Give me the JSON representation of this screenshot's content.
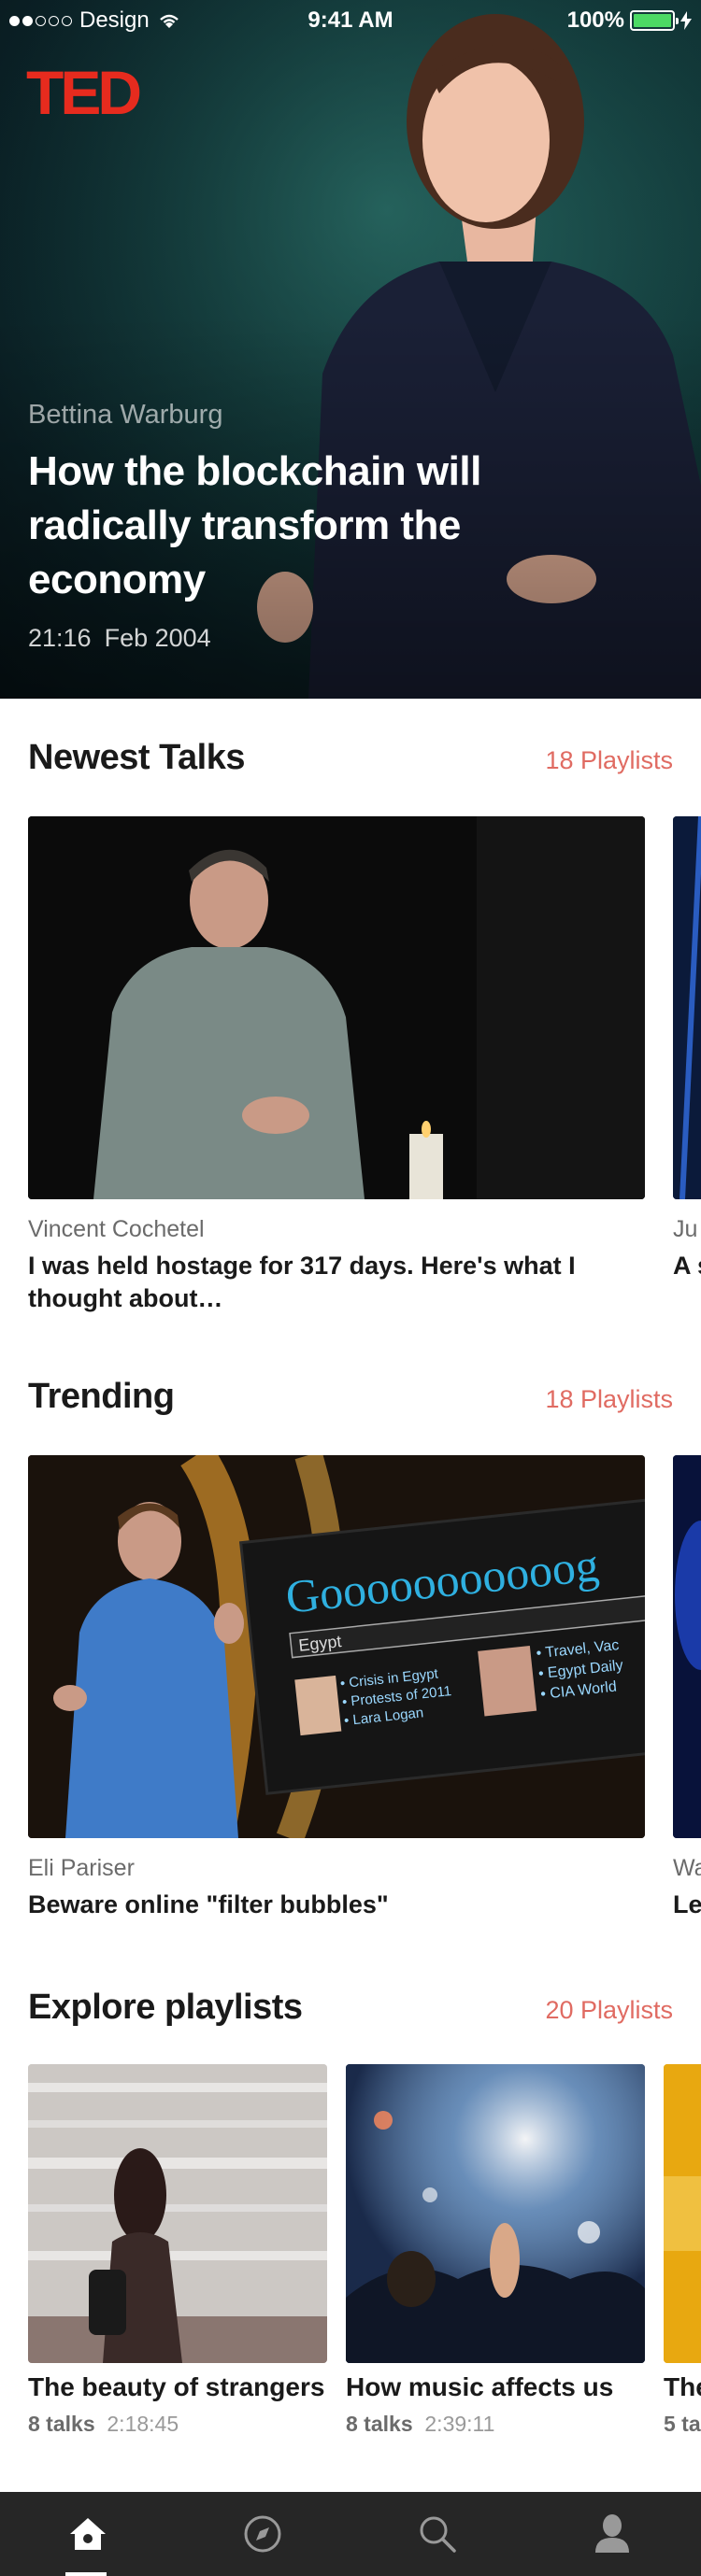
{
  "status_bar": {
    "carrier": "Design",
    "time": "9:41 AM",
    "battery": "100%"
  },
  "hero": {
    "logo": "TED",
    "speaker": "Bettina Warburg",
    "title": "How the blockchain will radically transform the economy",
    "duration": "21:16",
    "date": "Feb 2004"
  },
  "newest": {
    "title": "Newest Talks",
    "link": "18 Playlists",
    "cards": [
      {
        "speaker": "Vincent Cochetel",
        "title": "I was held hostage for 317 days. Here's what I thought about…"
      },
      {
        "speaker": "Ju",
        "title": "A s"
      }
    ]
  },
  "trending": {
    "title": "Trending",
    "link": "18 Playlists",
    "cards": [
      {
        "speaker": "Eli Pariser",
        "title": "Beware online \"filter bubbles\""
      },
      {
        "speaker": "Wa",
        "title": "Le"
      }
    ],
    "slide": {
      "headline": "Gooooooooooog",
      "search_box": "Egypt",
      "left_results": [
        "• Crisis in Egypt",
        "• Protests of 2011",
        "• Lara Logan"
      ],
      "right_results": [
        "• Travel, Vac",
        "• Egypt Daily",
        "• CIA World"
      ]
    }
  },
  "playlists": {
    "title": "Explore playlists",
    "link": "20 Playlists",
    "items": [
      {
        "title": "The beauty of strangers",
        "talks": "8 talks",
        "duration": "2:18:45"
      },
      {
        "title": "How music affects us",
        "talks": "8 talks",
        "duration": "2:39:11"
      },
      {
        "title": "The",
        "talks": "5 ta",
        "duration": ""
      }
    ]
  },
  "tabbar": {
    "tabs": [
      "home-icon",
      "compass-icon",
      "search-icon",
      "profile-icon"
    ],
    "active": "home-icon"
  },
  "colors": {
    "accent": "#e62b1e",
    "link": "#e06b62",
    "tabbar": "#262626"
  }
}
